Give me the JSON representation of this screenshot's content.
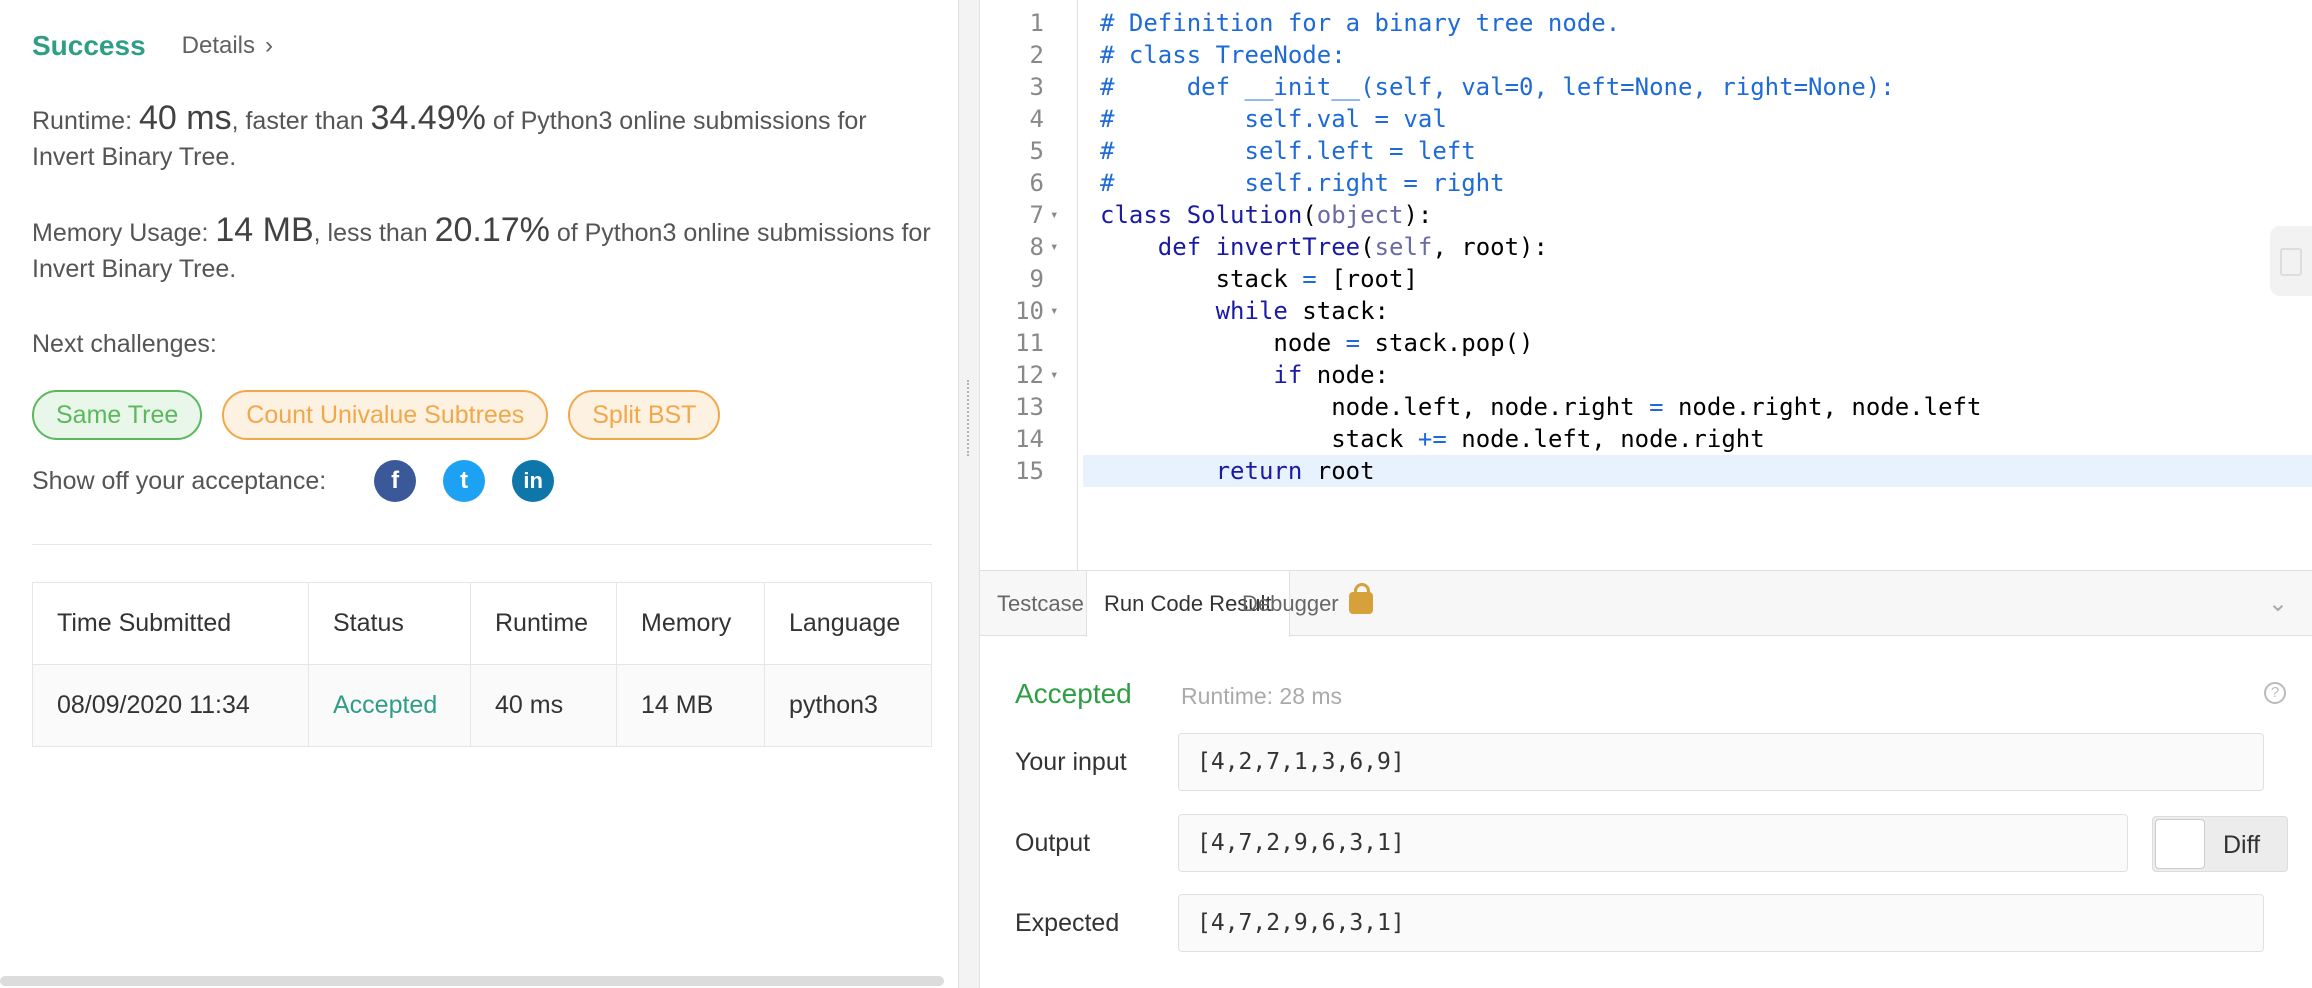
{
  "result": {
    "status": "Success",
    "details_label": "Details",
    "details_chevron": "›",
    "runtime_prefix": "Runtime: ",
    "runtime_value": "40 ms",
    "runtime_mid": ", faster than ",
    "runtime_pct": "34.49%",
    "runtime_suffix": " of Python3 online submissions for Invert Binary Tree.",
    "memory_prefix": "Memory Usage: ",
    "memory_value": "14 MB",
    "memory_mid": ", less than ",
    "memory_pct": "20.17%",
    "memory_suffix": " of Python3 online submissions for Invert Binary Tree.",
    "next_label": "Next challenges:",
    "challenges": [
      {
        "label": "Same Tree",
        "difficulty": "easy"
      },
      {
        "label": "Count Univalue Subtrees",
        "difficulty": "medium"
      },
      {
        "label": "Split BST",
        "difficulty": "medium"
      }
    ],
    "share_label": "Show off your acceptance:",
    "social": [
      {
        "icon": "facebook-icon",
        "glyph": "f",
        "color": "#3b5998"
      },
      {
        "icon": "twitter-icon",
        "glyph": "t",
        "color": "#1da1f2"
      },
      {
        "icon": "linkedin-icon",
        "glyph": "in",
        "color": "#0e76a8"
      }
    ]
  },
  "submissions": {
    "headers": [
      "Time Submitted",
      "Status",
      "Runtime",
      "Memory",
      "Language"
    ],
    "rows": [
      [
        "08/09/2020 11:34",
        "Accepted",
        "40 ms",
        "14 MB",
        "python3"
      ]
    ]
  },
  "editor": {
    "lines": [
      "# Definition for a binary tree node.",
      "# class TreeNode:",
      "#     def __init__(self, val=0, left=None, right=None):",
      "#         self.val = val",
      "#         self.left = left",
      "#         self.right = right",
      "class Solution(object):",
      "    def invertTree(self, root):",
      "        stack = [root]",
      "        while stack:",
      "            node = stack.pop()",
      "            if node:",
      "                node.left, node.right = node.right, node.left",
      "                stack += node.left, node.right",
      "        return root"
    ],
    "fold_lines": [
      7,
      8,
      10,
      12
    ],
    "active_line": 15
  },
  "console": {
    "tabs": [
      "Testcase",
      "Run Code Result",
      "Debugger"
    ],
    "active_tab": "Run Code Result",
    "status": "Accepted",
    "runtime": "Runtime: 28 ms",
    "input_label": "Your input",
    "input_value": "[4,2,7,1,3,6,9]",
    "output_label": "Output",
    "output_value": "[4,7,2,9,6,3,1]",
    "expected_label": "Expected",
    "expected_value": "[4,7,2,9,6,3,1]",
    "diff_label": "Diff",
    "help_glyph": "?",
    "collapse_glyph": "⌄"
  },
  "colors": {
    "success": "#2e9e87",
    "accepted_console": "#2e9e43",
    "easy": "#5cb85c",
    "medium": "#f0a84b",
    "comment": "#1e6ad8",
    "keyword": "#1a1aa6"
  }
}
